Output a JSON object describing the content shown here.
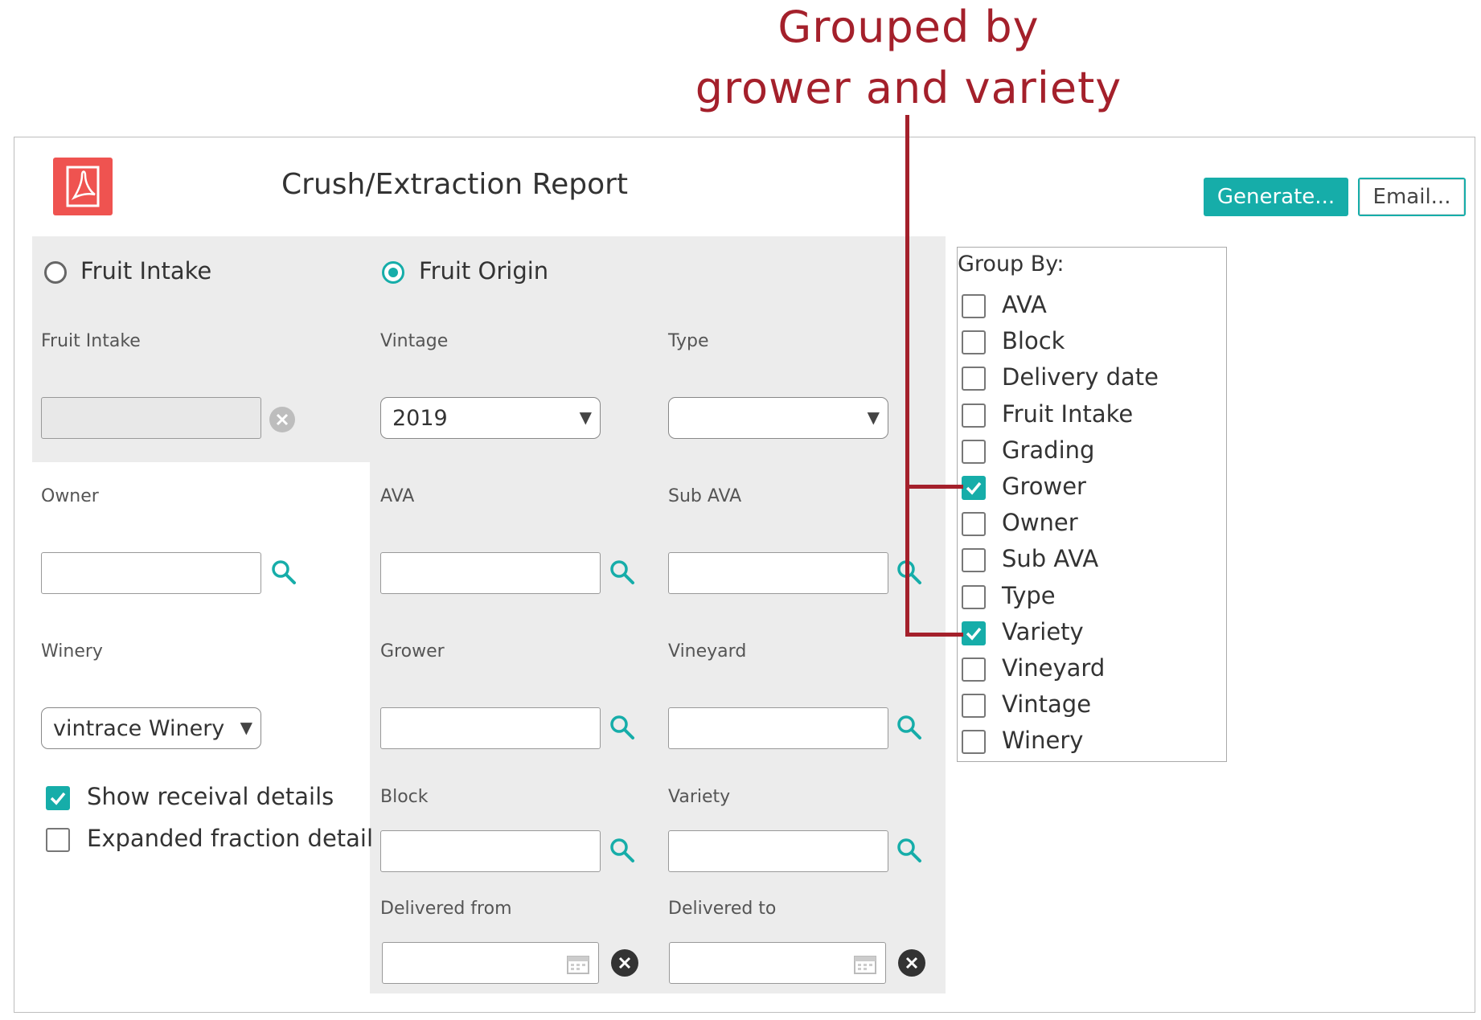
{
  "annotation": {
    "line1": "Grouped by",
    "line2": "grower and variety"
  },
  "header": {
    "title": "Crush/Extraction Report",
    "generate_label": "Generate...",
    "email_label": "Email..."
  },
  "source_options": {
    "fruit_intake_label": "Fruit Intake",
    "fruit_origin_label": "Fruit Origin",
    "selected": "Fruit Origin"
  },
  "left_fields": {
    "fruit_intake_label": "Fruit Intake",
    "fruit_intake_value": "",
    "owner_label": "Owner",
    "owner_value": "",
    "winery_label": "Winery",
    "winery_value": "vintrace Winery"
  },
  "options": {
    "show_receival_label": "Show receival details",
    "show_receival_checked": true,
    "expanded_fraction_label": "Expanded fraction detail",
    "expanded_fraction_checked": false
  },
  "origin_fields": {
    "vintage_label": "Vintage",
    "vintage_value": "2019",
    "type_label": "Type",
    "type_value": "",
    "ava_label": "AVA",
    "sub_ava_label": "Sub AVA",
    "grower_label": "Grower",
    "vineyard_label": "Vineyard",
    "block_label": "Block",
    "variety_label": "Variety",
    "delivered_from_label": "Delivered from",
    "delivered_to_label": "Delivered to"
  },
  "group_by": {
    "title": "Group By:",
    "items": [
      {
        "label": "AVA",
        "checked": false
      },
      {
        "label": "Block",
        "checked": false
      },
      {
        "label": "Delivery date",
        "checked": false
      },
      {
        "label": "Fruit Intake",
        "checked": false
      },
      {
        "label": "Grading",
        "checked": false
      },
      {
        "label": "Grower",
        "checked": true
      },
      {
        "label": "Owner",
        "checked": false
      },
      {
        "label": "Sub AVA",
        "checked": false
      },
      {
        "label": "Type",
        "checked": false
      },
      {
        "label": "Variety",
        "checked": true
      },
      {
        "label": "Vineyard",
        "checked": false
      },
      {
        "label": "Vintage",
        "checked": false
      },
      {
        "label": "Winery",
        "checked": false
      }
    ]
  },
  "colors": {
    "accent": "#16ada9",
    "annotation": "#a4202b",
    "pdf_icon": "#ef5350",
    "panel_grey": "#ececec"
  },
  "icons": [
    "pdf-icon",
    "search-icon",
    "clear-icon",
    "calendar-icon",
    "checkmark-icon",
    "chevron-down-icon"
  ]
}
